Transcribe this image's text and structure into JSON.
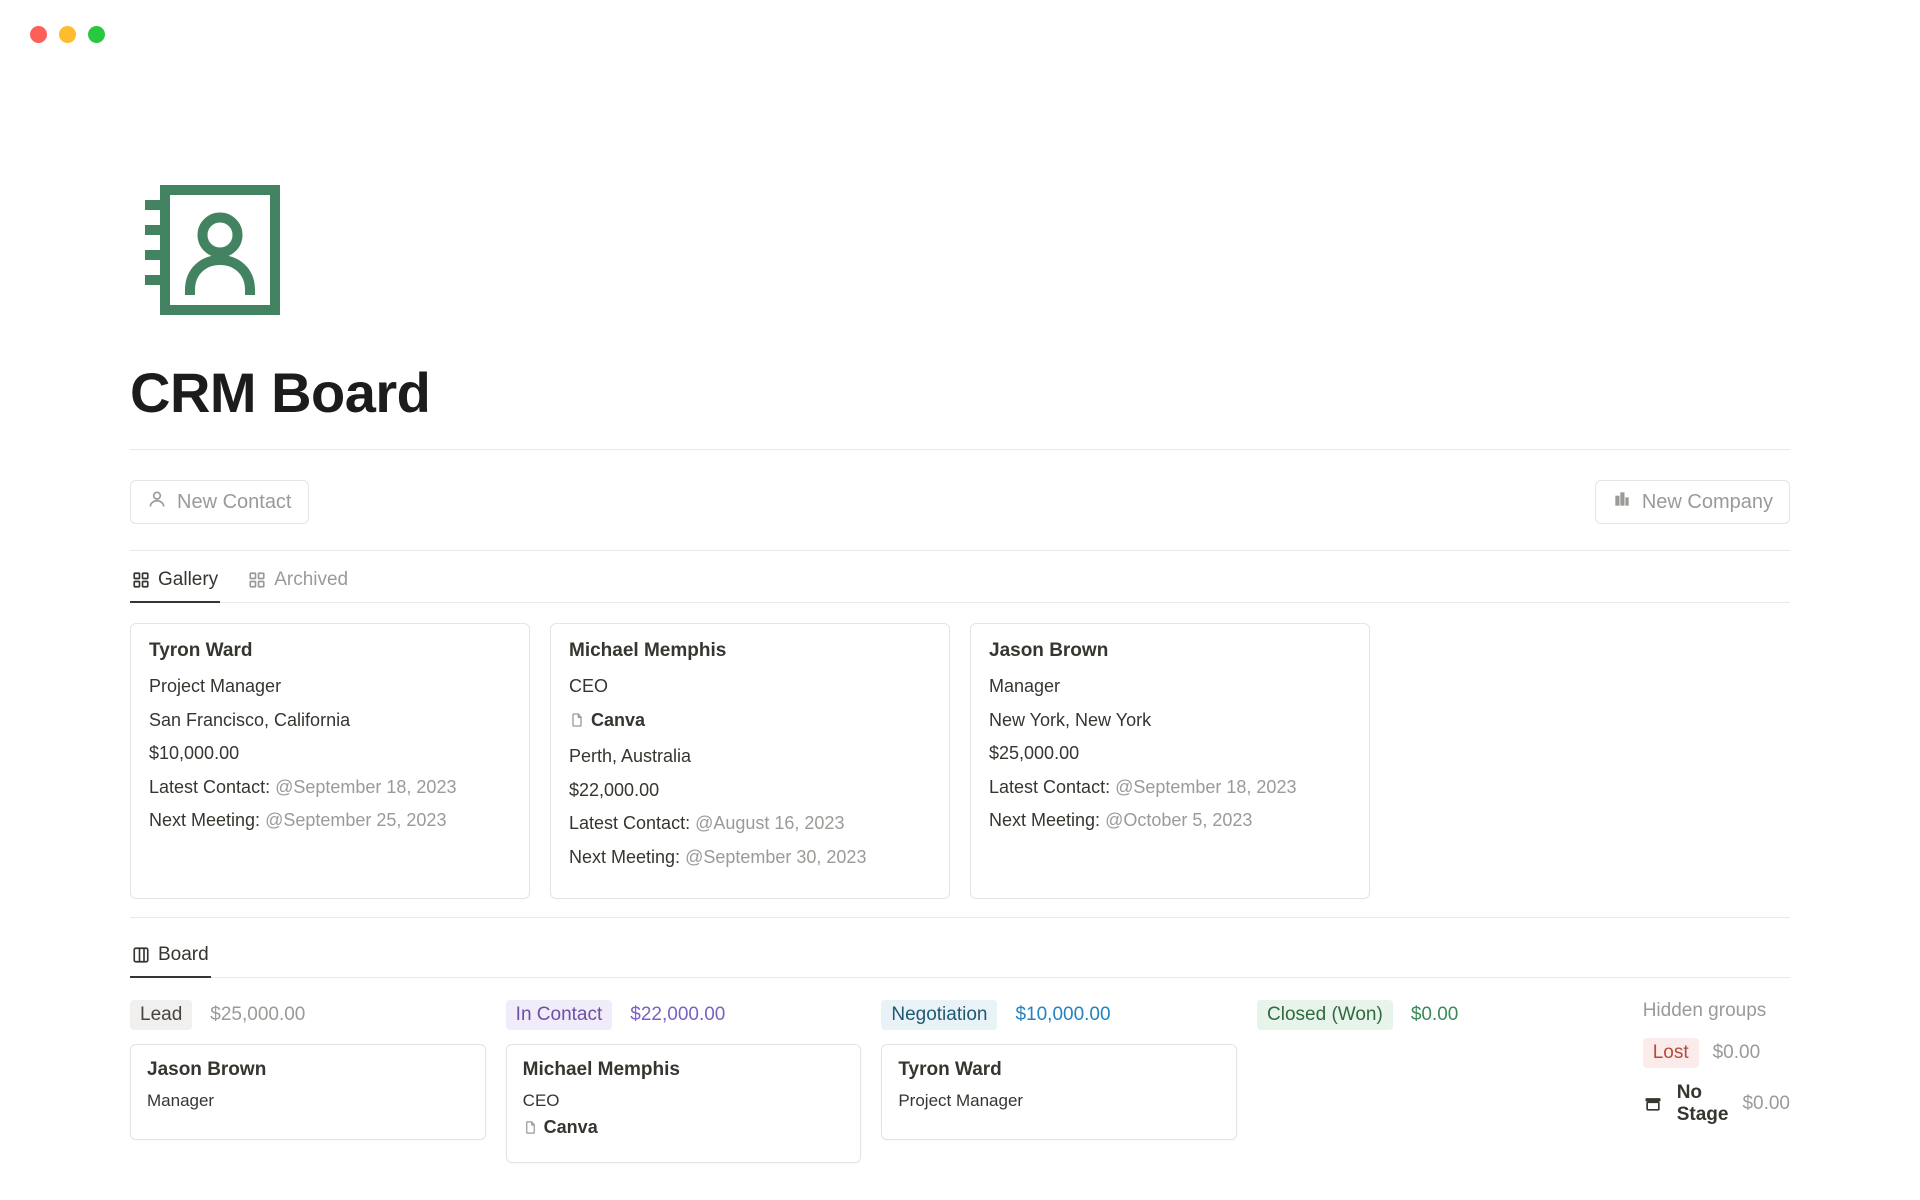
{
  "page": {
    "title": "CRM Board",
    "icon_color": "#448361"
  },
  "actions": {
    "new_contact": "New Contact",
    "new_company": "New Company"
  },
  "tabs": {
    "gallery": "Gallery",
    "archived": "Archived",
    "board": "Board"
  },
  "labels": {
    "latest_contact": "Latest Contact:",
    "next_meeting": "Next Meeting:",
    "hidden_groups": "Hidden groups",
    "no_stage": "No Stage"
  },
  "gallery_cards": [
    {
      "name": "Tyron Ward",
      "role": "Project Manager",
      "company": null,
      "location": "San Francisco, California",
      "amount": "$10,000.00",
      "latest_contact": "@September 18, 2023",
      "next_meeting": "@September 25, 2023"
    },
    {
      "name": "Michael Memphis",
      "role": "CEO",
      "company": "Canva",
      "location": "Perth, Australia",
      "amount": "$22,000.00",
      "latest_contact": "@August 16, 2023",
      "next_meeting": "@September 30, 2023"
    },
    {
      "name": "Jason Brown",
      "role": "Manager",
      "company": null,
      "location": "New York, New York",
      "amount": "$25,000.00",
      "latest_contact": "@September 18, 2023",
      "next_meeting": "@October 5, 2023"
    }
  ],
  "board": {
    "columns": [
      {
        "stage": "Lead",
        "pill_class": "pill-lead",
        "amount": "$25,000.00",
        "amt_class": "",
        "card": {
          "name": "Jason Brown",
          "role": "Manager",
          "company": null
        }
      },
      {
        "stage": "In Contact",
        "pill_class": "pill-contact",
        "amount": "$22,000.00",
        "amt_class": "purple",
        "card": {
          "name": "Michael Memphis",
          "role": "CEO",
          "company": "Canva"
        }
      },
      {
        "stage": "Negotiation",
        "pill_class": "pill-negotiation",
        "amount": "$10,000.00",
        "amt_class": "blue",
        "card": {
          "name": "Tyron Ward",
          "role": "Project Manager",
          "company": null
        }
      },
      {
        "stage": "Closed (Won)",
        "pill_class": "pill-won",
        "amount": "$0.00",
        "amt_class": "green",
        "card": null
      }
    ],
    "hidden": {
      "lost_label": "Lost",
      "lost_amount": "$0.00",
      "nostage_amount": "$0.00"
    }
  }
}
